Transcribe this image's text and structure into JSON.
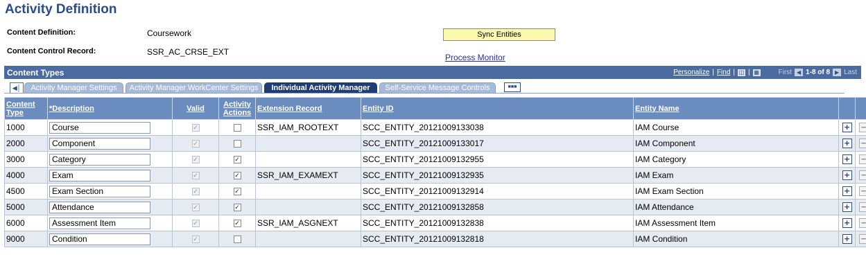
{
  "page": {
    "title": "Activity Definition"
  },
  "header": {
    "content_definition_label": "Content Definition:",
    "content_definition_value": "Coursework",
    "content_control_label": "Content Control Record:",
    "content_control_value": "SSR_AC_CRSE_EXT",
    "sync_button": "Sync Entities",
    "process_monitor_link": "Process Monitor"
  },
  "grid": {
    "title": "Content Types",
    "personalize": "Personalize",
    "find": "Find",
    "first": "First",
    "range": "1-8 of 8",
    "last": "Last",
    "separator": "|"
  },
  "tabs": [
    {
      "label": "Activity Manager Settings",
      "active": false
    },
    {
      "label": "Activity Manager WorkCenter Settings",
      "active": false
    },
    {
      "label": "Individual Activity Manager",
      "active": true
    },
    {
      "label": "Self-Service Message Controls",
      "active": false
    }
  ],
  "columns": {
    "content_type": "Content Type",
    "description": "*Description",
    "valid": "Valid",
    "activity_actions": "Activity Actions",
    "extension_record": "Extension Record",
    "entity_id": "Entity ID",
    "entity_name": "Entity Name"
  },
  "rows": [
    {
      "content_type": "1000",
      "description": "Course",
      "valid": true,
      "activity_actions": false,
      "extension_record": "SSR_IAM_ROOTEXT",
      "entity_id": "SCC_ENTITY_20121009133038",
      "entity_name": "IAM Course"
    },
    {
      "content_type": "2000",
      "description": "Component",
      "valid": true,
      "activity_actions": false,
      "extension_record": "",
      "entity_id": "SCC_ENTITY_20121009133017",
      "entity_name": "IAM Component"
    },
    {
      "content_type": "3000",
      "description": "Category",
      "valid": true,
      "activity_actions": true,
      "extension_record": "",
      "entity_id": "SCC_ENTITY_20121009132955",
      "entity_name": "IAM Category"
    },
    {
      "content_type": "4000",
      "description": "Exam",
      "valid": true,
      "activity_actions": true,
      "extension_record": "SSR_IAM_EXAMEXT",
      "entity_id": "SCC_ENTITY_20121009132935",
      "entity_name": "IAM Exam"
    },
    {
      "content_type": "4500",
      "description": "Exam Section",
      "valid": true,
      "activity_actions": true,
      "extension_record": "",
      "entity_id": "SCC_ENTITY_20121009132914",
      "entity_name": "IAM Exam Section"
    },
    {
      "content_type": "5000",
      "description": "Attendance",
      "valid": true,
      "activity_actions": true,
      "extension_record": "",
      "entity_id": "SCC_ENTITY_20121009132858",
      "entity_name": "IAM Attendance"
    },
    {
      "content_type": "6000",
      "description": "Assessment Item",
      "valid": true,
      "activity_actions": true,
      "extension_record": "SSR_IAM_ASGNEXT",
      "entity_id": "SCC_ENTITY_20121009132838",
      "entity_name": "IAM Assessment Item"
    },
    {
      "content_type": "9000",
      "description": "Condition",
      "valid": true,
      "activity_actions": false,
      "extension_record": "",
      "entity_id": "SCC_ENTITY_20121009132818",
      "entity_name": "IAM Condition"
    }
  ],
  "icons": {
    "zoom": "zoom-grid-icon",
    "download": "download-grid-icon",
    "first_arrow": "first-arrow-icon",
    "last_arrow": "last-arrow-icon",
    "add_row": "add-row-icon",
    "delete_row": "delete-row-icon"
  },
  "colors": {
    "title": "#2a4d89",
    "grid_header": "#4a6b9f",
    "column_header": "#6a8cbf",
    "active_tab": "#1f3d73",
    "inactive_tab": "#a7bad8",
    "sync_button": "#fbf8b0",
    "alt_row": "#e6eaf1"
  }
}
